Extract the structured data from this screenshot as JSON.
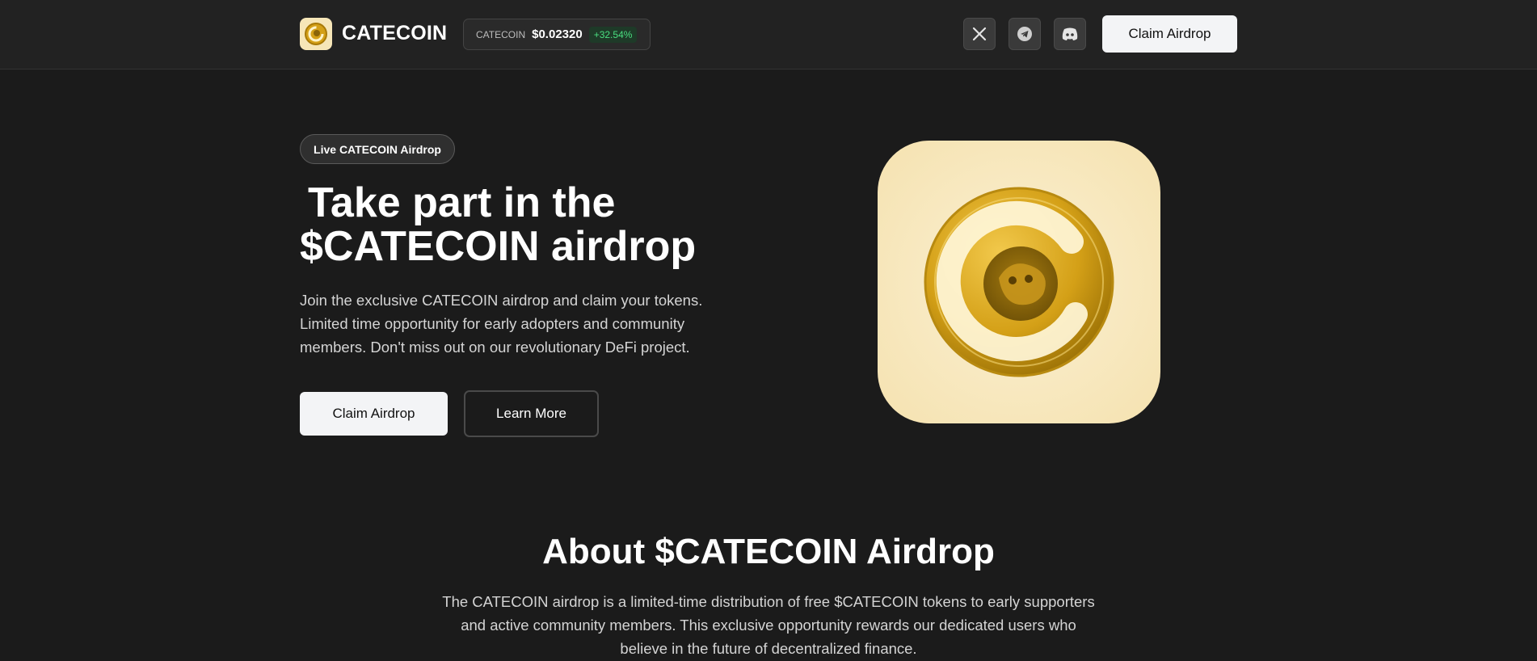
{
  "header": {
    "brand": "CATECOIN",
    "ticker": {
      "symbol": "CATECOIN",
      "price": "$0.02320",
      "change": "+32.54%"
    },
    "socials": [
      {
        "icon": "x-twitter-icon"
      },
      {
        "icon": "telegram-icon"
      },
      {
        "icon": "discord-icon"
      }
    ],
    "claim_label": "Claim Airdrop"
  },
  "hero": {
    "badge": "Live CATECOIN Airdrop",
    "title_line1": "Take part in the",
    "title_line2": "$CATECOIN airdrop",
    "description": "Join the exclusive CATECOIN airdrop and claim your tokens. Limited time opportunity for early adopters and community members. Don't miss out on our revolutionary DeFi project.",
    "claim_label": "Claim Airdrop",
    "learn_more_label": "Learn More"
  },
  "about": {
    "title": "About $CATECOIN Airdrop",
    "description": "The CATECOIN airdrop is a limited-time distribution of free $CATECOIN tokens to early supporters and active community members. This exclusive opportunity rewards our dedicated users who believe in the future of decentralized finance."
  },
  "colors": {
    "background": "#1b1b1b",
    "header_bg": "#222222",
    "coin_gold": "#d4a017",
    "tile_cream": "#f6e6b8",
    "positive": "#4ade80"
  }
}
